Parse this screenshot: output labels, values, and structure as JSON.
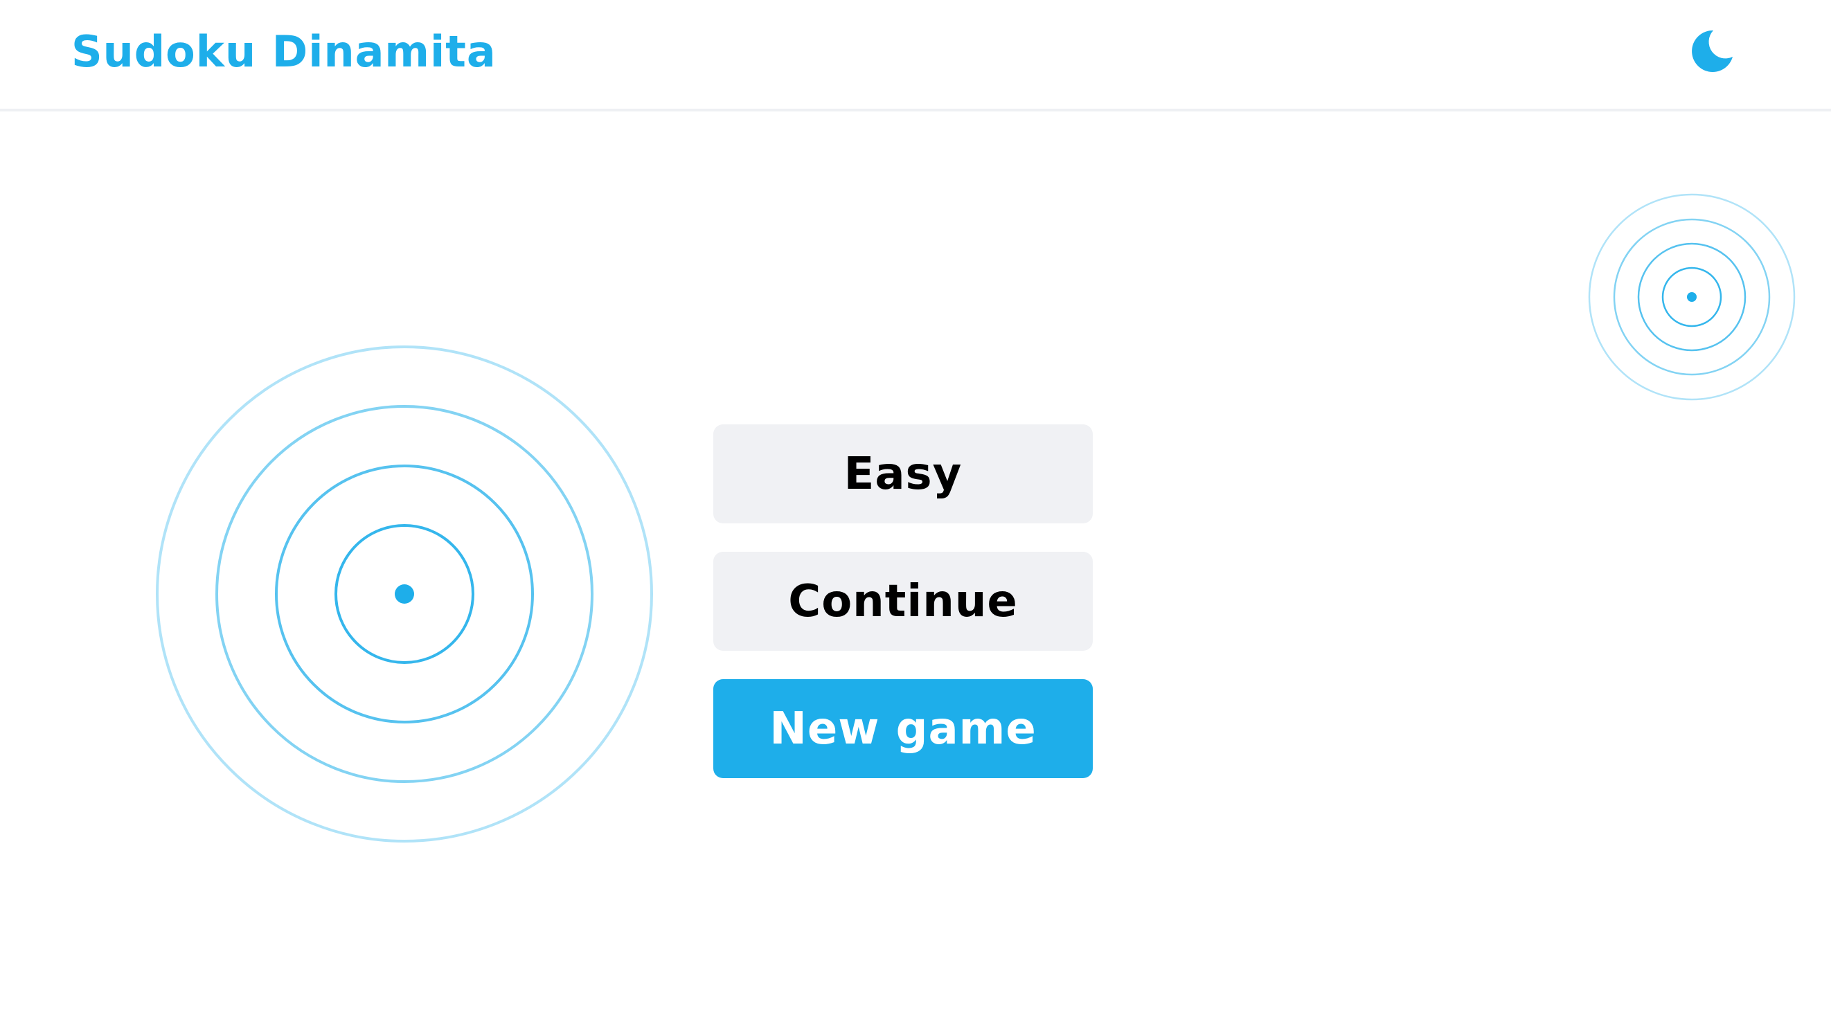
{
  "header": {
    "title": "Sudoku Dinamita",
    "theme_toggle_icon": "moon-icon"
  },
  "menu": {
    "difficulty_label": "Easy",
    "continue_label": "Continue",
    "new_game_label": "New game"
  },
  "colors": {
    "accent": "#1eaeea",
    "button_bg": "#f0f1f4",
    "text": "#000000",
    "header_border": "#eef0f3"
  },
  "decorations": {
    "left": "ripple-circles",
    "right": "ripple-circles"
  }
}
